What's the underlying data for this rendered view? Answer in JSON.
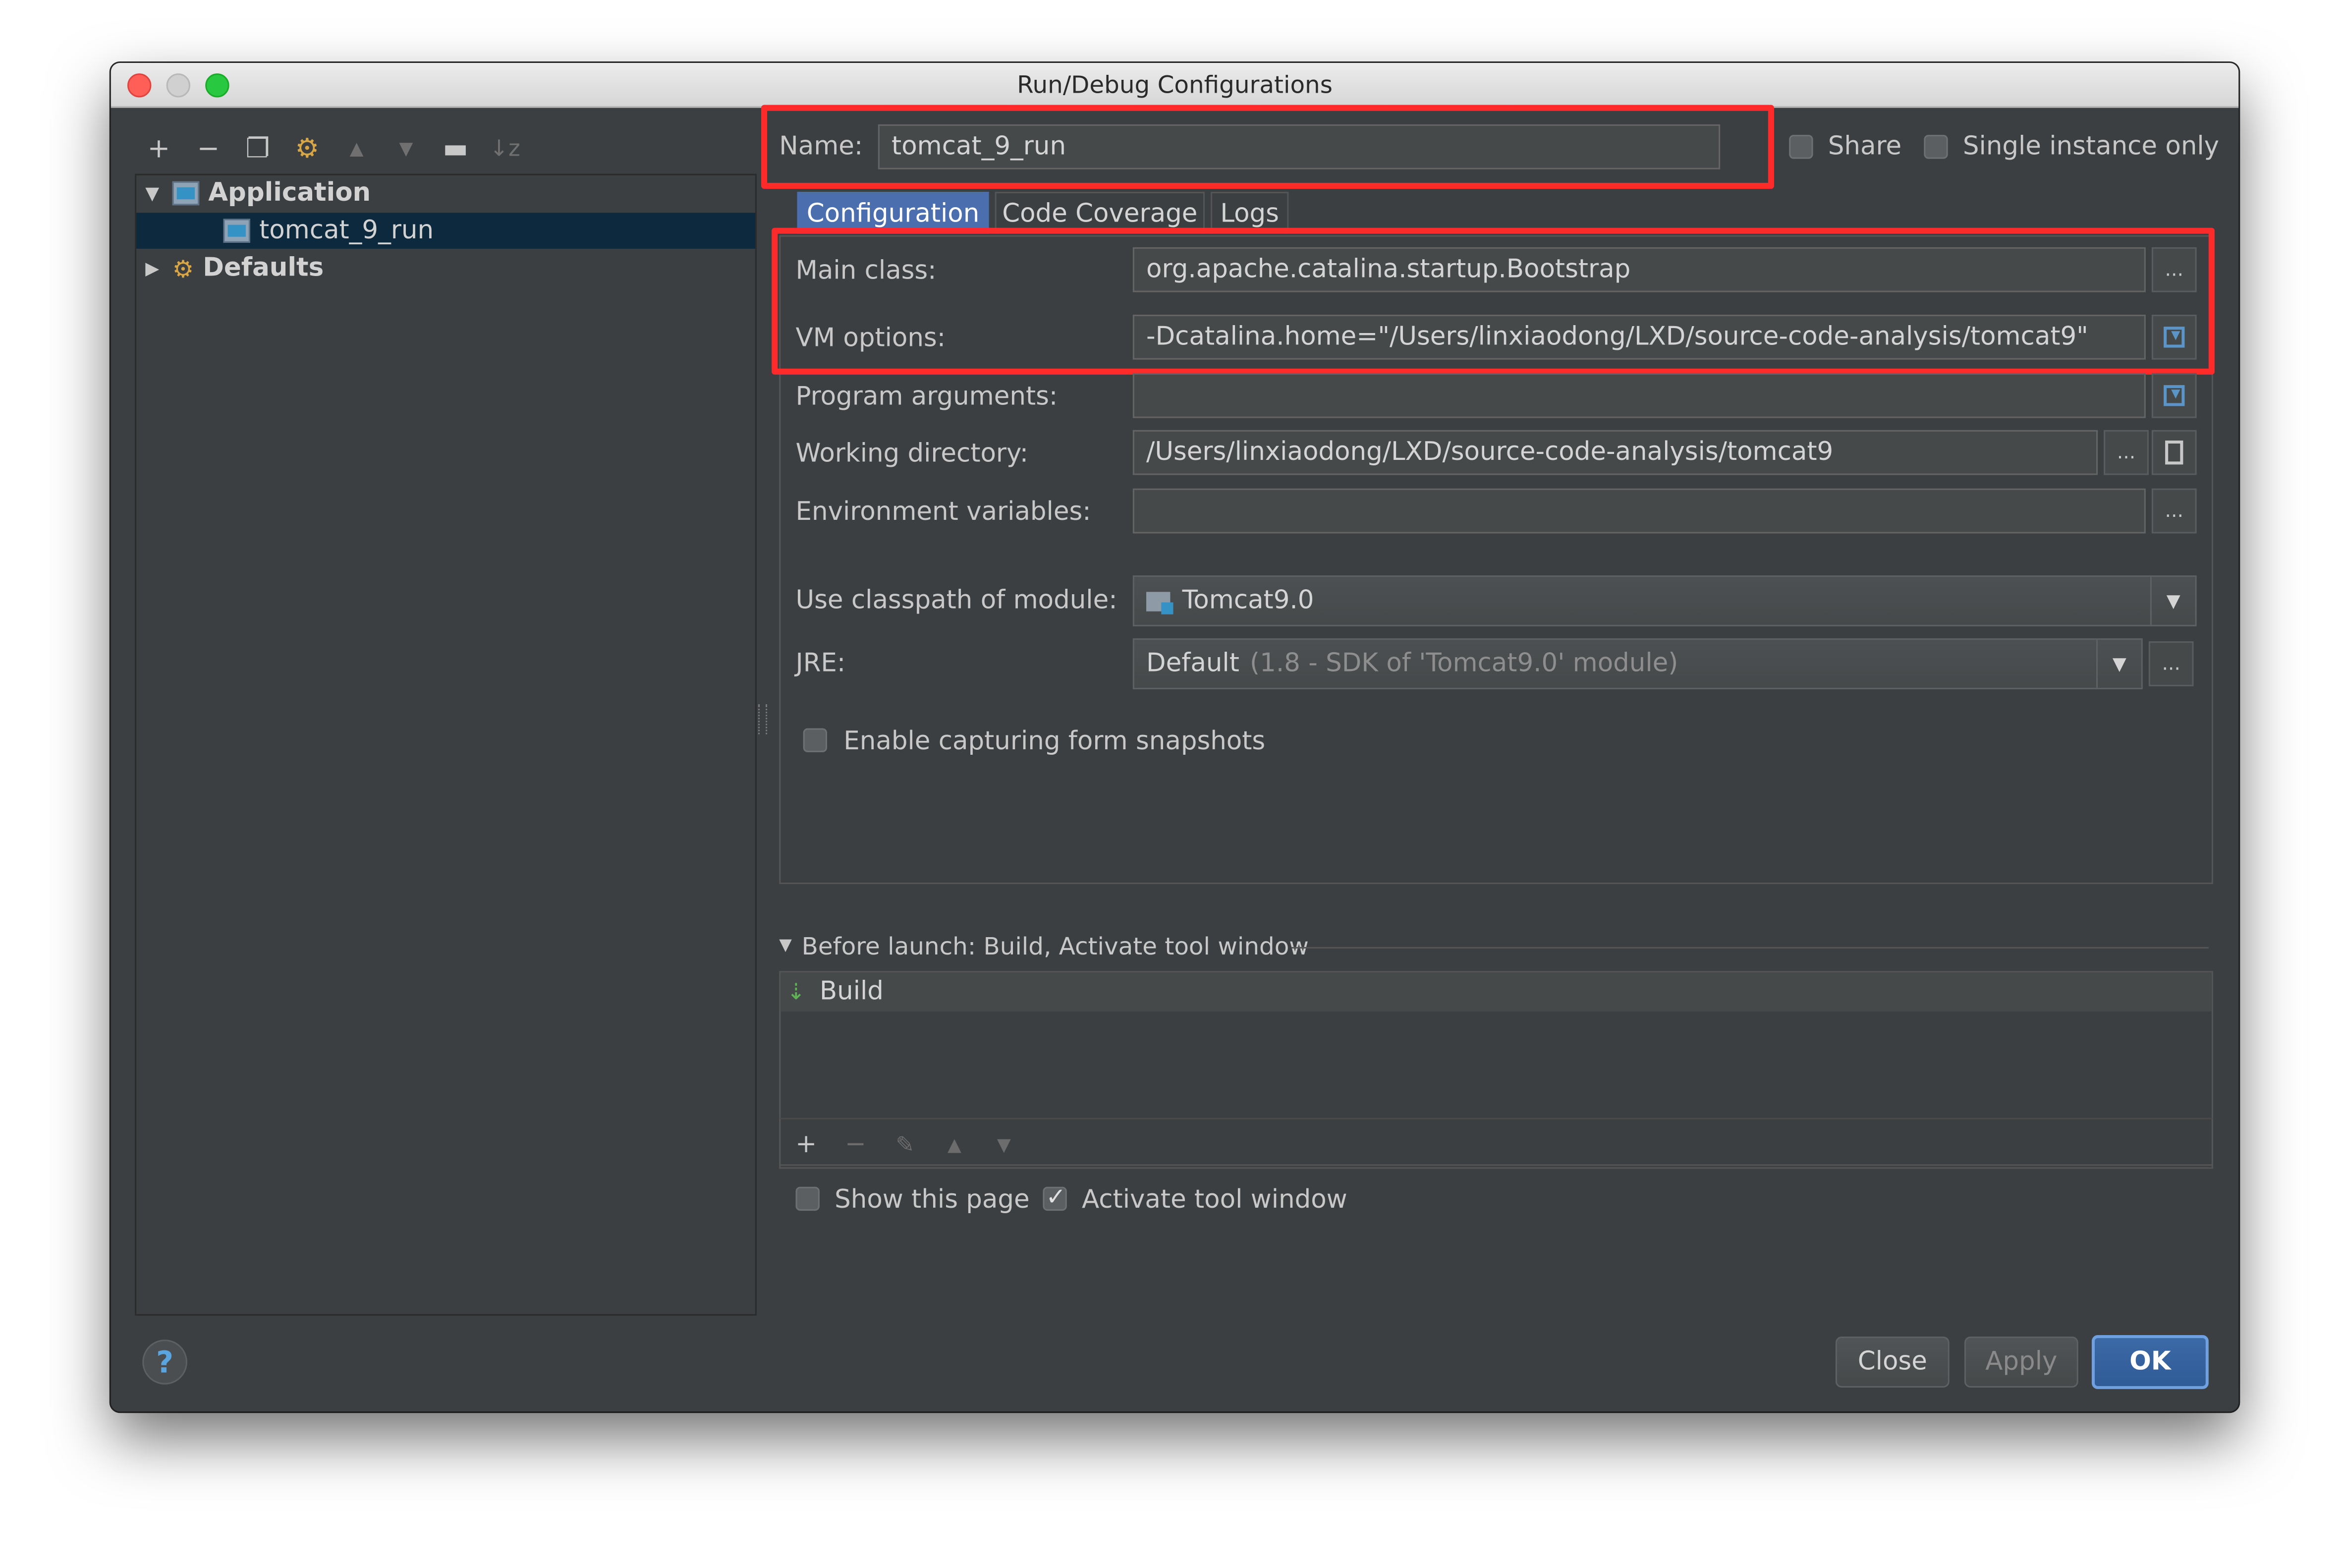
{
  "window": {
    "title": "Run/Debug Configurations"
  },
  "sidebar": {
    "toolbar_icons": [
      "add-icon",
      "remove-icon",
      "copy-icon",
      "wrench-icon",
      "move-up-icon",
      "move-down-icon",
      "folder-icon",
      "sort-icon"
    ],
    "tree": [
      {
        "label": "Application",
        "expanded": true
      },
      {
        "label": "tomcat_9_run",
        "selected": true
      },
      {
        "label": "Defaults",
        "expanded": false
      }
    ]
  },
  "header": {
    "name_label": "Name:",
    "name_value": "tomcat_9_run",
    "share_label": "Share",
    "single_instance_label": "Single instance only"
  },
  "tabs": [
    {
      "label": "Configuration",
      "active": true
    },
    {
      "label": "Code Coverage",
      "active": false
    },
    {
      "label": "Logs",
      "active": false
    }
  ],
  "config": {
    "main_class_label": "Main class:",
    "main_class_value": "org.apache.catalina.startup.Bootstrap",
    "vm_options_label": "VM options:",
    "vm_options_value": "-Dcatalina.home=\"/Users/linxiaodong/LXD/source-code-analysis/tomcat9\"",
    "program_args_label": "Program arguments:",
    "program_args_value": "",
    "working_dir_label": "Working directory:",
    "working_dir_value": "/Users/linxiaodong/LXD/source-code-analysis/tomcat9",
    "env_vars_label": "Environment variables:",
    "env_vars_value": "",
    "classpath_label": "Use classpath of module:",
    "classpath_value": "Tomcat9.0",
    "jre_label": "JRE:",
    "jre_value": "Default",
    "jre_detail": "(1.8 - SDK of 'Tomcat9.0' module)",
    "snapshots_label": "Enable capturing form snapshots",
    "ellipsis": "..."
  },
  "before_launch": {
    "title": "Before launch: Build, Activate tool window",
    "items": [
      "Build"
    ],
    "show_page_label": "Show this page",
    "activate_label": "Activate tool window"
  },
  "buttons": {
    "close": "Close",
    "apply": "Apply",
    "ok": "OK",
    "help": "?"
  },
  "colors": {
    "highlight_box": "#ff2a2a",
    "dialog_bg": "#3c3f41",
    "selection": "#0d293e",
    "primary": "#2f5b96"
  }
}
